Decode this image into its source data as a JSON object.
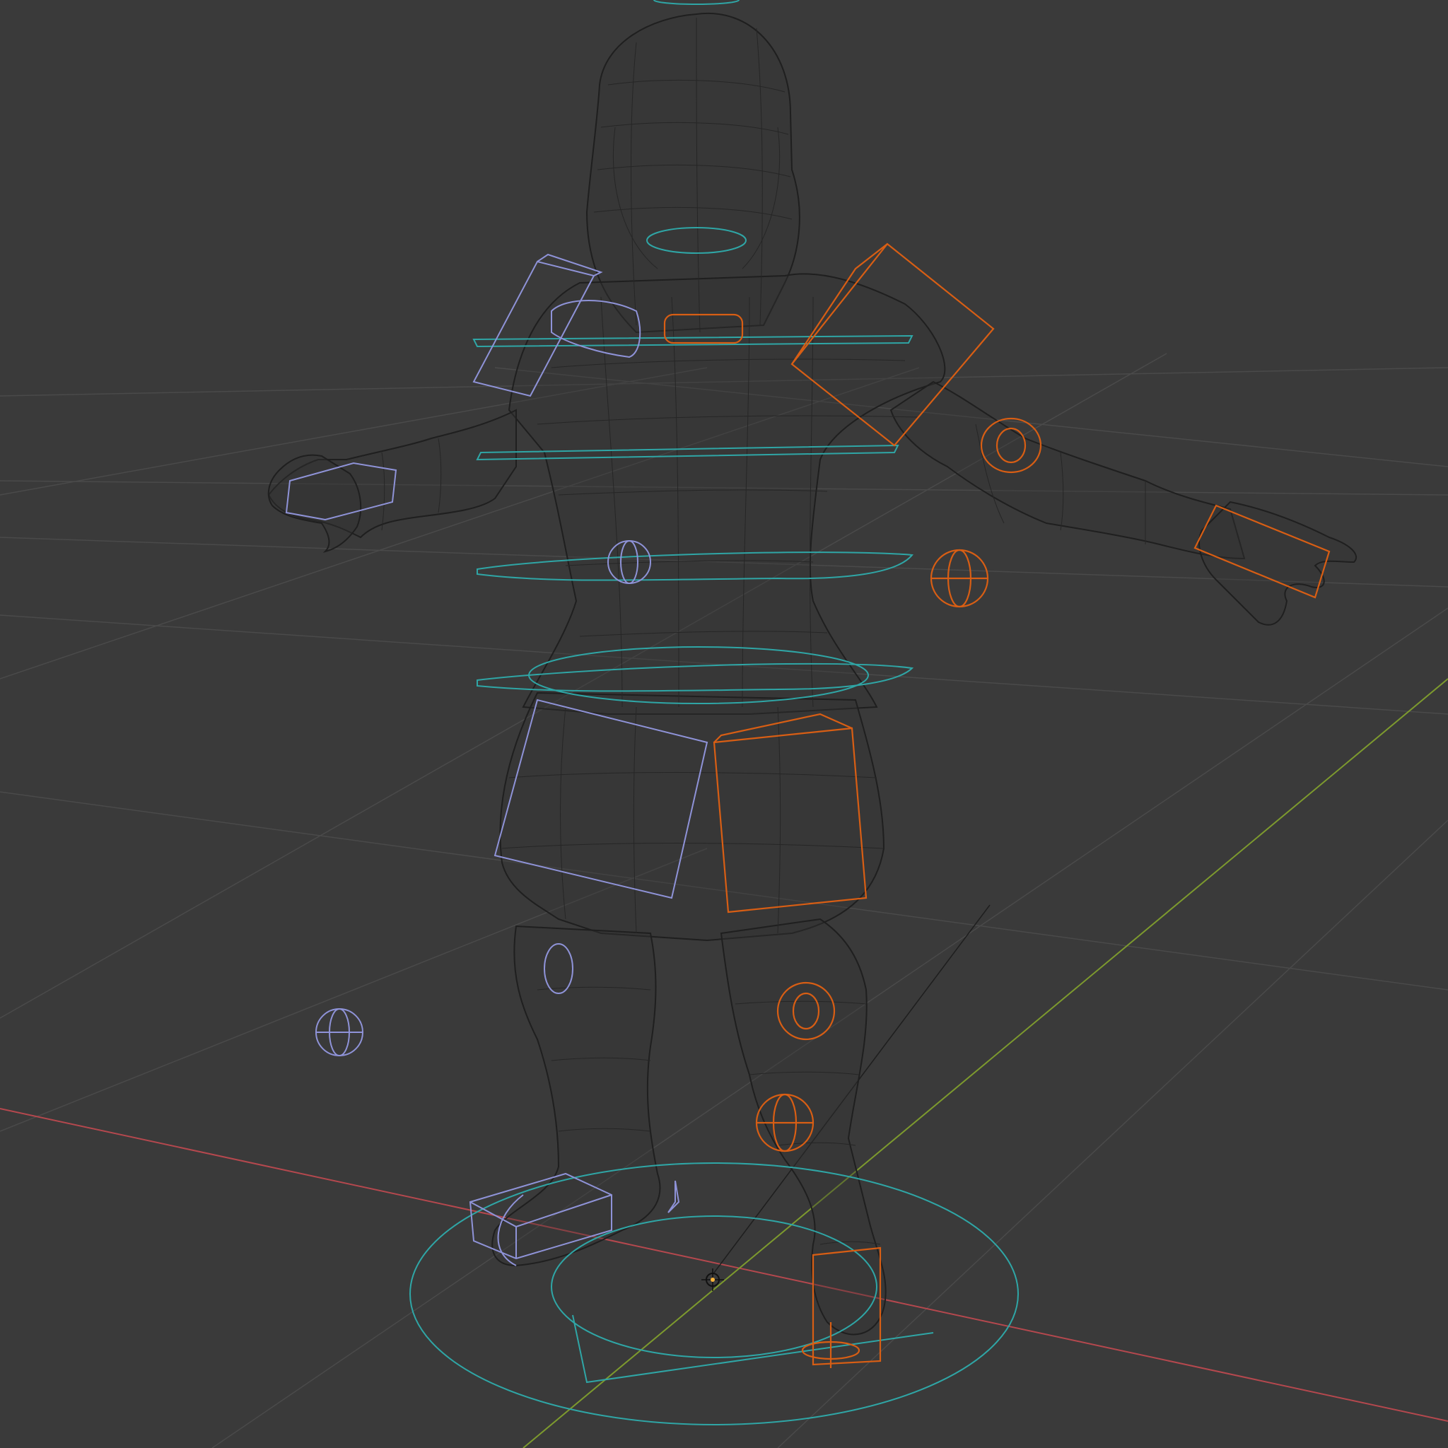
{
  "viewport": {
    "background": "#3a3a3a",
    "shading": "wireframe",
    "colors": {
      "grid": "#4a4a4a",
      "x_axis": "#b5484e",
      "y_axis": "#7d9a2e",
      "mesh_wire": "#1f1f1f",
      "rig_center": "#2fa6a6",
      "rig_left": "#8f93d8",
      "rig_right": "#d85e14",
      "origin": "#ffb43a"
    }
  },
  "scene": {
    "mesh": "character-wireframe",
    "armature_controls": [
      "head-ring",
      "chest-rings",
      "spine-rings",
      "hip-ring",
      "root-circle",
      "ik-hand-boxes",
      "ik-foot-boxes",
      "pole-target-spheres",
      "shoulder-box",
      "thigh-box"
    ],
    "origin_marker": "3d-cursor-icon"
  }
}
